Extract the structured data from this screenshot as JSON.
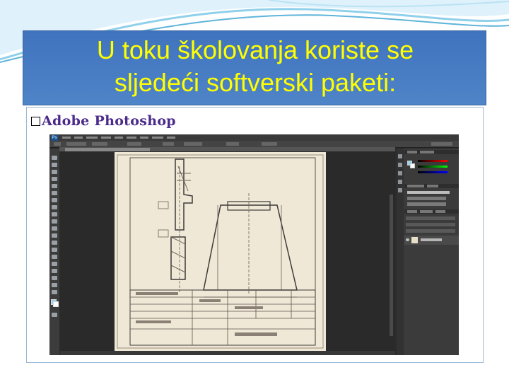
{
  "slide": {
    "title_line1": "U toku školovanja koriste se",
    "title_line2": "sljedeći softverski paketi:",
    "title_color": "#ffff00",
    "title_bg": "#4a7cc3",
    "bullet": "",
    "subheading": "Adobe Photoshop",
    "subheading_color": "#4a2a8a"
  },
  "screenshot": {
    "app": "Photoshop",
    "logo": "Ps",
    "tools_icon": "toolbox-icon",
    "document": "technical-drawing-scan",
    "layer_thumb": "layer-thumbnail-icon"
  }
}
